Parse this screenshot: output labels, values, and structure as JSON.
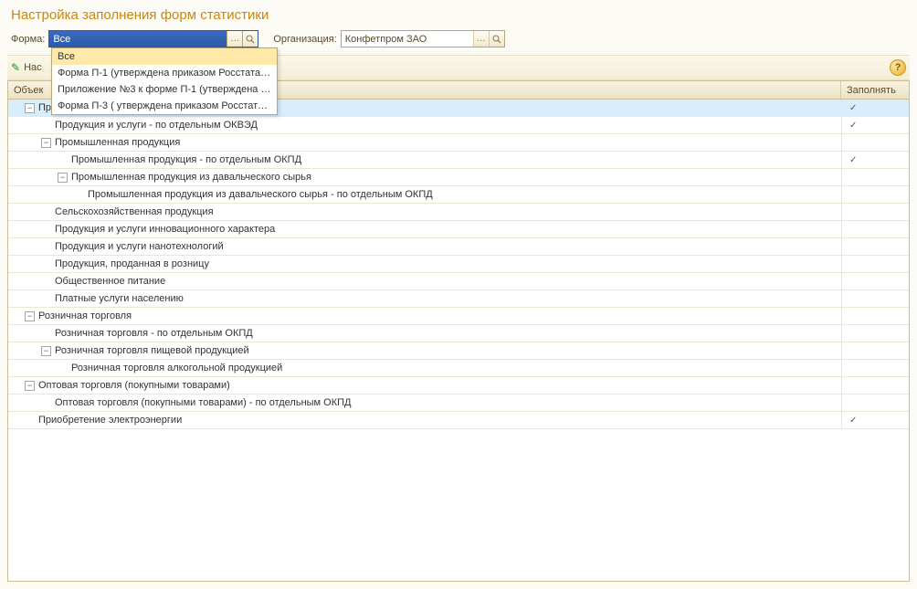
{
  "title": "Настройка заполнения форм статистики",
  "filters": {
    "form_label": "Форма:",
    "form_value": "Все",
    "org_label": "Организация:",
    "org_value": "Конфетпром ЗАО"
  },
  "dropdown": {
    "items": [
      "Все",
      "Форма П-1 (утверждена приказом Росстата ...",
      "Приложение №3 к форме П-1 (утверждена п...",
      "Форма П-3 ( утверждена приказом Росстата..."
    ],
    "highlight_index": 0
  },
  "toolbar": {
    "customize_label": "Нас"
  },
  "grid": {
    "col1": "Объек",
    "col2": "Заполнять"
  },
  "rows": [
    {
      "indent": 0,
      "expander": "minus",
      "text": "Продукция и услуги",
      "fill": true,
      "highlight": true
    },
    {
      "indent": 1,
      "expander": "none",
      "text": "Продукция и услуги - по отдельным ОКВЭД",
      "fill": true
    },
    {
      "indent": 1,
      "expander": "minus",
      "text": "Промышленная продукция",
      "fill": false
    },
    {
      "indent": 2,
      "expander": "none",
      "text": "Промышленная продукция - по отдельным ОКПД",
      "fill": true
    },
    {
      "indent": 2,
      "expander": "minus",
      "text": "Промышленная продукция из давальческого сырья",
      "fill": false
    },
    {
      "indent": 3,
      "expander": "none",
      "text": "Промышленная продукция из давальческого сырья - по отдельным ОКПД",
      "fill": false
    },
    {
      "indent": 1,
      "expander": "none",
      "text": "Сельскохозяйственная продукция",
      "fill": false
    },
    {
      "indent": 1,
      "expander": "none",
      "text": "Продукция и услуги инновационного характера",
      "fill": false
    },
    {
      "indent": 1,
      "expander": "none",
      "text": "Продукция и услуги нанотехнологий",
      "fill": false
    },
    {
      "indent": 1,
      "expander": "none",
      "text": "Продукция, проданная в розницу",
      "fill": false
    },
    {
      "indent": 1,
      "expander": "none",
      "text": "Общественное питание",
      "fill": false
    },
    {
      "indent": 1,
      "expander": "none",
      "text": "Платные услуги населению",
      "fill": false
    },
    {
      "indent": 0,
      "expander": "minus",
      "text": "Розничная торговля",
      "fill": false
    },
    {
      "indent": 1,
      "expander": "none",
      "text": "Розничная торговля - по отдельным ОКПД",
      "fill": false
    },
    {
      "indent": 1,
      "expander": "minus",
      "text": "Розничная торговля пищевой продукцией",
      "fill": false
    },
    {
      "indent": 2,
      "expander": "none",
      "text": "Розничная торговля алкогольной продукцией",
      "fill": false
    },
    {
      "indent": 0,
      "expander": "minus",
      "text": "Оптовая торговля (покупными товарами)",
      "fill": false
    },
    {
      "indent": 1,
      "expander": "none",
      "text": "Оптовая торговля (покупными товарами) - по отдельным ОКПД",
      "fill": false
    },
    {
      "indent": 0,
      "expander": "none",
      "text": "Приобретение электроэнергии",
      "fill": true
    }
  ]
}
